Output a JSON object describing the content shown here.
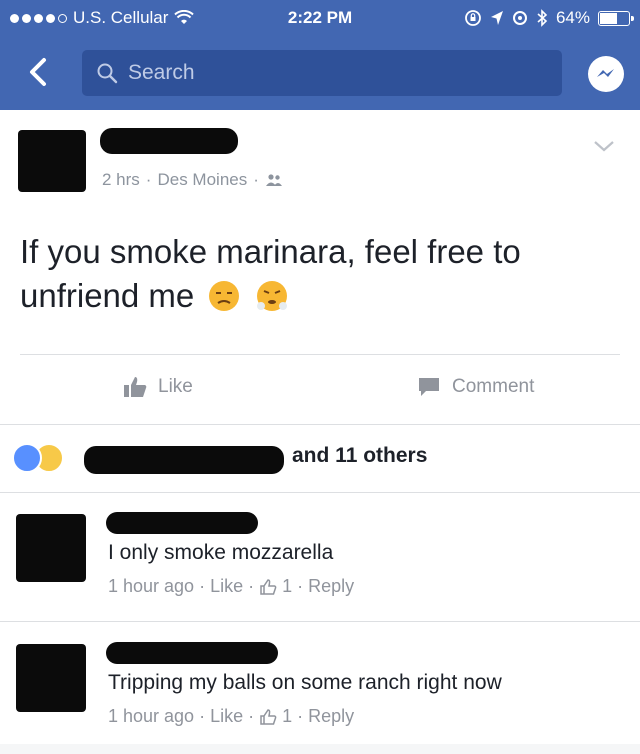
{
  "status_bar": {
    "carrier": "U.S. Cellular",
    "time": "2:22 PM",
    "battery": "64%",
    "battery_level": 0.64,
    "icons": [
      "signal-dots-icon",
      "wifi-icon",
      "lock-rotation-icon",
      "location-icon",
      "alarm-icon",
      "bluetooth-icon",
      "battery-icon"
    ]
  },
  "nav": {
    "search_placeholder": "Search",
    "icons": [
      "back-icon",
      "search-icon",
      "messenger-icon"
    ]
  },
  "post": {
    "meta_time": "2 hrs",
    "meta_location": "Des Moines",
    "meta_sep": "·",
    "text": "If you smoke marinara, feel free to unfriend me",
    "emojis": [
      "unamused-face-icon",
      "steam-nose-face-icon"
    ],
    "like_label": "Like",
    "comment_label": "Comment"
  },
  "reactions": {
    "others_text": "and 11 others",
    "icons": [
      "like-reaction-icon",
      "haha-reaction-icon"
    ]
  },
  "comments": [
    {
      "text": "I only smoke mozzarella",
      "time": "1 hour ago",
      "like": "Like",
      "likes_count": "1",
      "reply": "Reply"
    },
    {
      "text": "Tripping my balls on some ranch right now",
      "time": "1 hour ago",
      "like": "Like",
      "likes_count": "1",
      "reply": "Reply"
    }
  ],
  "colors": {
    "brand": "#4267b2",
    "meta_text": "#90949c",
    "body_text": "#1d2129"
  }
}
